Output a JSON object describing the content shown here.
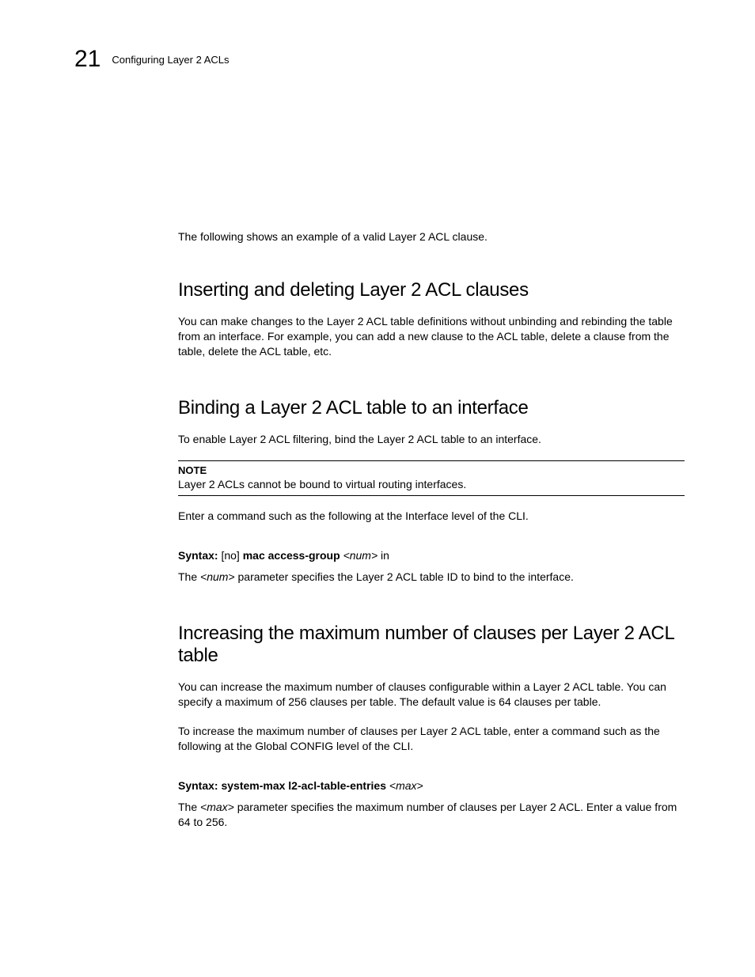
{
  "header": {
    "chapter_number": "21",
    "chapter_title": "Configuring Layer 2 ACLs"
  },
  "intro": {
    "p1": "The following shows an example of a valid Layer 2 ACL clause."
  },
  "section1": {
    "heading": "Inserting and deleting Layer 2 ACL clauses",
    "p1": "You can make changes to the Layer 2 ACL table definitions without unbinding and rebinding the table from an interface.  For example, you can add a new clause to the ACL table, delete a clause from the table, delete the ACL table, etc."
  },
  "section2": {
    "heading": "Binding a Layer 2 ACL table to an interface",
    "p1": "To enable Layer 2 ACL filtering, bind the Layer 2 ACL table to an interface.",
    "note_label": "NOTE",
    "note_text": "Layer 2 ACLs cannot be bound to virtual routing interfaces.",
    "p2": "Enter a command such as the following at the Interface level of the CLI.",
    "syntax_label": "Syntax:",
    "syntax_pre": "[no] ",
    "syntax_cmd": "mac access-group",
    "syntax_var": "<num>",
    "syntax_post": " in",
    "p3_a": "The ",
    "p3_var": "<num>",
    "p3_b": " parameter specifies the Layer 2 ACL table ID to bind to the interface."
  },
  "section3": {
    "heading": "Increasing the maximum number of clauses per Layer 2 ACL table",
    "p1": "You can increase the maximum number of clauses configurable within a Layer 2 ACL table.  You can specify a maximum of 256 clauses per table. The default value is 64 clauses per table.",
    "p2": "To increase the maximum number of clauses per Layer 2 ACL table, enter a command such as the following at the Global CONFIG level of the CLI.",
    "syntax_label": "Syntax:",
    "syntax_cmd": "system-max l2-acl-table-entries",
    "syntax_var": "<max>",
    "p3_a": "The ",
    "p3_var": "<max>",
    "p3_b": " parameter specifies the maximum number of clauses per Layer 2 ACL.  Enter a value from 64 to 256."
  }
}
